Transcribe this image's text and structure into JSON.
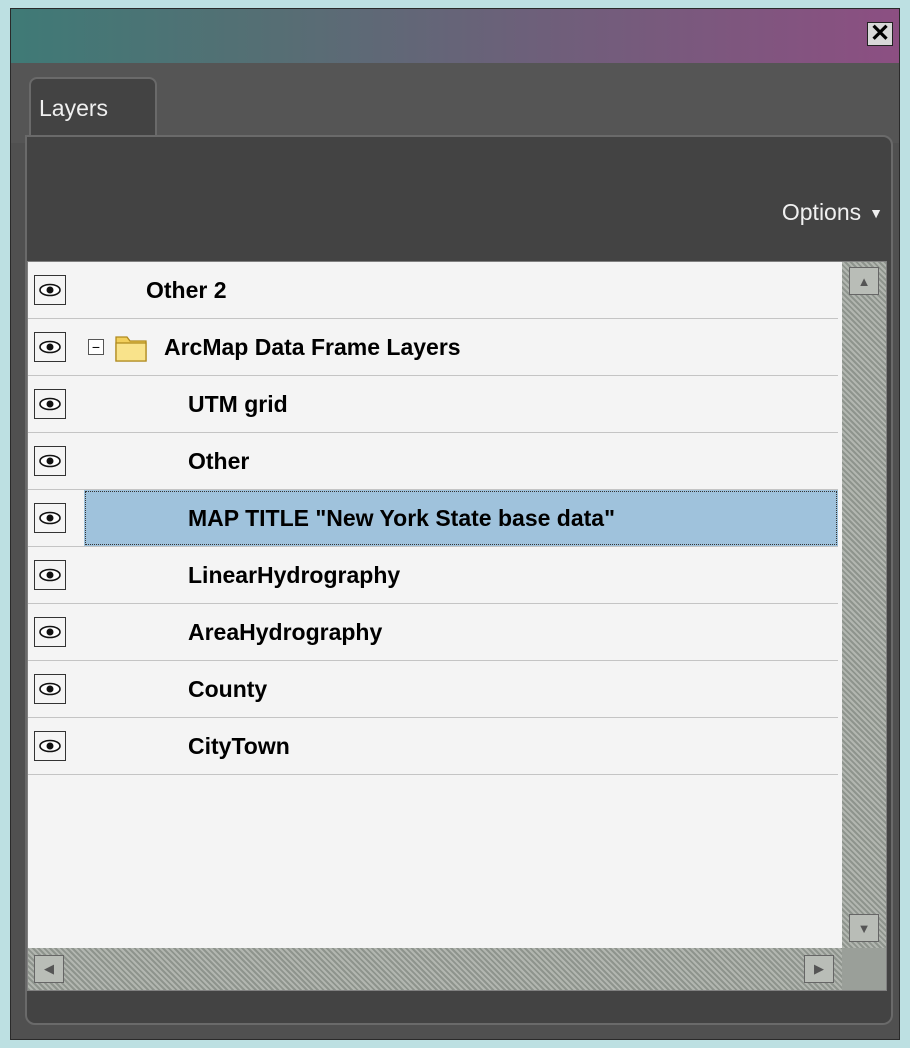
{
  "window": {
    "close_symbol": "✕"
  },
  "tabs": [
    {
      "label": "Layers",
      "active": true
    }
  ],
  "toolbar": {
    "options_label": "Options",
    "options_caret": "▼"
  },
  "layers": {
    "top_item": {
      "label": "Other 2",
      "visible": true
    },
    "group": {
      "label": "ArcMap Data Frame Layers",
      "expander_symbol": "−",
      "expanded": true,
      "icon": "folder-icon",
      "visible": true
    },
    "children": [
      {
        "label": "UTM grid",
        "visible": true,
        "selected": false
      },
      {
        "label": "Other",
        "visible": true,
        "selected": false
      },
      {
        "label": "MAP TITLE \"New York State base data\"",
        "visible": true,
        "selected": true
      },
      {
        "label": "LinearHydrography",
        "visible": true,
        "selected": false
      },
      {
        "label": "AreaHydrography",
        "visible": true,
        "selected": false
      },
      {
        "label": "County",
        "visible": true,
        "selected": false
      },
      {
        "label": "CityTown",
        "visible": true,
        "selected": false
      }
    ]
  },
  "scroll": {
    "up_arrow": "▲",
    "down_arrow": "▼",
    "left_arrow": "◀",
    "right_arrow": "▶"
  },
  "colors": {
    "selection": "#9fc2dc",
    "panel": "#434343",
    "list_background": "#f4f4f4"
  }
}
